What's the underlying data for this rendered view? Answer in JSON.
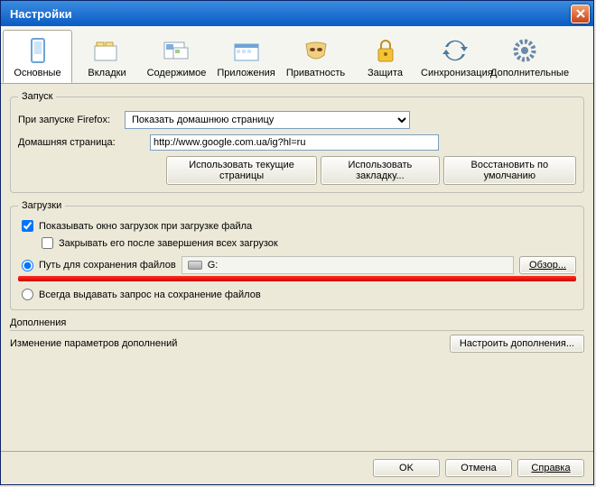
{
  "title": "Настройки",
  "tabs": [
    {
      "label": "Основные"
    },
    {
      "label": "Вкладки"
    },
    {
      "label": "Содержимое"
    },
    {
      "label": "Приложения"
    },
    {
      "label": "Приватность"
    },
    {
      "label": "Защита"
    },
    {
      "label": "Синхронизация"
    },
    {
      "label": "Дополнительные"
    }
  ],
  "startup": {
    "legend": "Запуск",
    "when_label": "При запуске Firefox:",
    "when_value": "Показать домашнюю страницу",
    "home_label": "Домашняя страница:",
    "home_value": "http://www.google.com.ua/ig?hl=ru",
    "btn_current": "Использовать текущие страницы",
    "btn_bookmark": "Использовать закладку...",
    "btn_restore": "Восстановить по умолчанию"
  },
  "downloads": {
    "legend": "Загрузки",
    "show_window": "Показывать окно загрузок при загрузке файла",
    "close_after": "Закрывать его после завершения всех загрузок",
    "save_path_label": "Путь для сохранения файлов",
    "drive": "G:",
    "browse": "Обзор...",
    "always_ask": "Всегда выдавать запрос на сохранение файлов"
  },
  "addons": {
    "legend": "Дополнения",
    "desc": "Изменение параметров дополнений",
    "configure": "Настроить дополнения..."
  },
  "footer": {
    "ok": "OK",
    "cancel": "Отмена",
    "help": "Справка"
  }
}
